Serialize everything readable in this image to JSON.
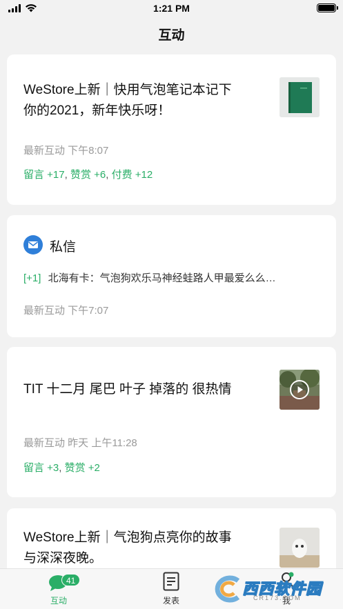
{
  "status_bar": {
    "time": "1:21 PM"
  },
  "nav": {
    "title": "互动"
  },
  "cards": [
    {
      "title_line1": "WeStore上新｜快用气泡笔记本记下",
      "title_line2": "你的2021，新年快乐呀！",
      "meta": "最新互动  下午8:07",
      "stats": [
        {
          "label": "留言 +17"
        },
        {
          "label": "赞赏 +6"
        },
        {
          "label": "付费 +12"
        }
      ],
      "thumb_color": "#1f7a55"
    },
    {
      "heading": "私信",
      "message_badge": "[+1]",
      "message_text": "北海有卡：气泡狗欢乐马神经蛙路人甲最爱么么…",
      "meta": "最新互动  下午7:07"
    },
    {
      "title_line1": "TIT 十二月 尾巴 叶子 掉落的 很热情",
      "meta": "最新互动 昨天 上午11:28",
      "stats": [
        {
          "label": "留言 +3"
        },
        {
          "label": "赞赏 +2"
        }
      ]
    },
    {
      "title_line1": "WeStore上新｜气泡狗点亮你的故事",
      "title_line2": "与深深夜晚。"
    }
  ],
  "tabbar": {
    "tabs": [
      {
        "label": "互动",
        "badge": "41",
        "active": true
      },
      {
        "label": "发表"
      },
      {
        "label": "我"
      }
    ]
  },
  "watermark": {
    "text": "西西软件园",
    "subtext": "CR173.COM"
  },
  "colors": {
    "accent": "#2aae67",
    "mail_blue": "#2f7fd9"
  }
}
